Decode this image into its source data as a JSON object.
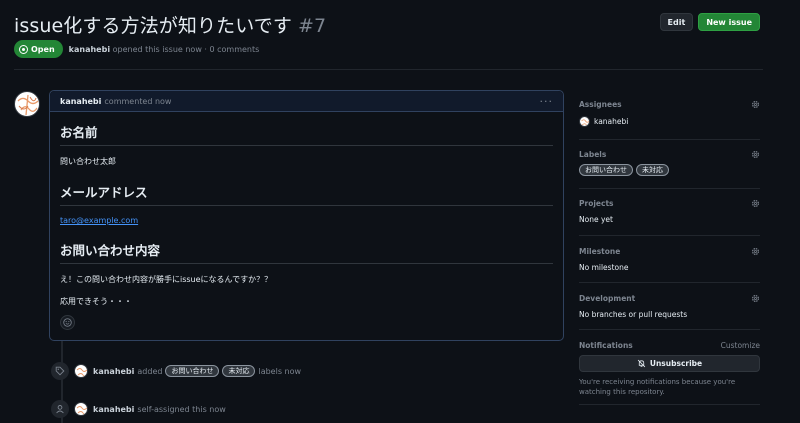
{
  "issue": {
    "title": "issue化する方法が知りたいです",
    "number": "#7",
    "state": "Open",
    "author": "kanahebi",
    "meta": "opened this issue now · 0 comments",
    "edit_label": "Edit",
    "new_issue_label": "New issue"
  },
  "comment": {
    "author": "kanahebi",
    "when": "commented now",
    "menu": "···",
    "h_name": "お名前",
    "name_value": "問い合わせ太郎",
    "h_email": "メールアドレス",
    "email_value": "taro@example.com",
    "h_content": "お問い合わせ内容",
    "content_line1": "え！この問い合わせ内容が勝手にissueになるんですか？？",
    "content_line2": "応用できそう・・・"
  },
  "timeline": {
    "event1": {
      "actor": "kanahebi",
      "verb": "added",
      "labels": [
        "お問い合わせ",
        "未対応"
      ],
      "suffix": "labels now"
    },
    "event2": {
      "actor": "kanahebi",
      "text": "self-assigned this now"
    }
  },
  "sidebar": {
    "assignees": {
      "title": "Assignees",
      "value": "kanahebi"
    },
    "labels": {
      "title": "Labels",
      "items": [
        "お問い合わせ",
        "未対応"
      ]
    },
    "projects": {
      "title": "Projects",
      "value": "None yet"
    },
    "milestone": {
      "title": "Milestone",
      "value": "No milestone"
    },
    "development": {
      "title": "Development",
      "value": "No branches or pull requests"
    },
    "notifications": {
      "title": "Notifications",
      "customize": "Customize",
      "button": "Unsubscribe",
      "note": "You're receiving notifications because you're watching this repository."
    }
  },
  "colors": {
    "bg": "#0d1117",
    "open_green": "#238636",
    "link_blue": "#4493f8",
    "muted": "#7d8590"
  }
}
